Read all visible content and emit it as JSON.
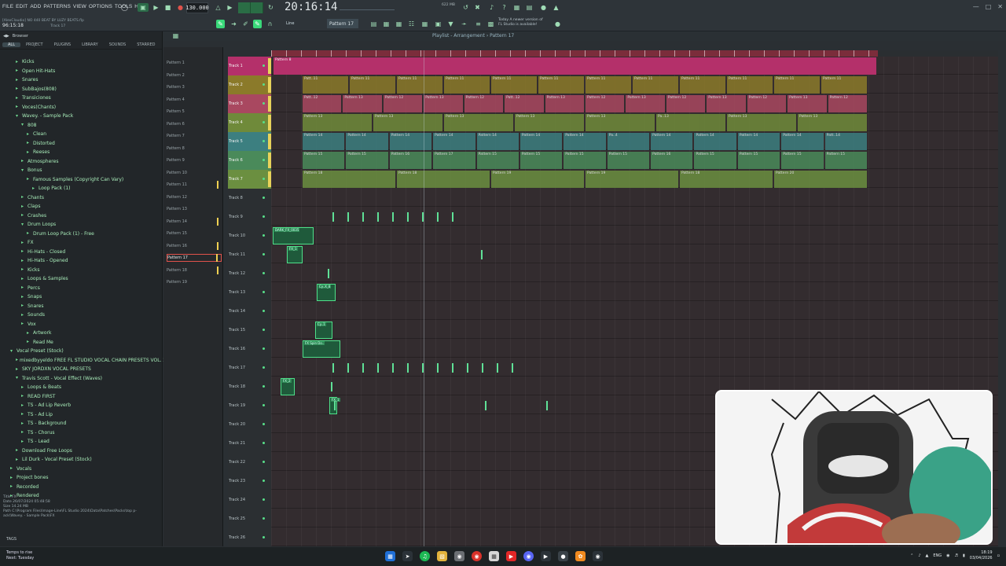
{
  "menu": [
    "FILE",
    "EDIT",
    "ADD",
    "PATTERNS",
    "VIEW",
    "OPTIONS",
    "TOOLS",
    "HELP"
  ],
  "tempo": "130.000",
  "clock": "20:16:14",
  "memory": "622 MB",
  "project_info": {
    "line1": "[AlexClaudio] NO 440 BEAT BY LUZY BEATS.flp",
    "position": "96:15:18",
    "track": "Track 17"
  },
  "pattern_selector": "Pattern 17",
  "snap_label": "Line",
  "update_note": [
    "Today  A newer version of",
    "FL Studio is available!"
  ],
  "browser": {
    "title": "Browser",
    "tabs": [
      "ALL",
      "PROJECT",
      "PLUGINS",
      "LIBRARY",
      "SOUNDS",
      "STARRED"
    ],
    "tree": [
      {
        "label": "Kicks",
        "indent": 2
      },
      {
        "label": "Open Hit-Hats",
        "indent": 2
      },
      {
        "label": "Snares",
        "indent": 2
      },
      {
        "label": "SubBajos(808)",
        "indent": 2
      },
      {
        "label": "Transiciones",
        "indent": 2
      },
      {
        "label": "Voces(Chants)",
        "indent": 2
      },
      {
        "label": "Wavey. - Sample Pack",
        "indent": 2,
        "open": true
      },
      {
        "label": "808",
        "indent": 3,
        "open": true
      },
      {
        "label": "Clean",
        "indent": 4
      },
      {
        "label": "Distorted",
        "indent": 4
      },
      {
        "label": "Reeses",
        "indent": 4
      },
      {
        "label": "Atmospheres",
        "indent": 3
      },
      {
        "label": "Bonus",
        "indent": 3,
        "open": true
      },
      {
        "label": "Famous Samples (Copyright Can Vary)",
        "indent": 4
      },
      {
        "label": "Loop Pack (1)",
        "indent": 5
      },
      {
        "label": "Chants",
        "indent": 3
      },
      {
        "label": "Claps",
        "indent": 3
      },
      {
        "label": "Crashes",
        "indent": 3
      },
      {
        "label": "Drum Loops",
        "indent": 3,
        "open": true
      },
      {
        "label": "Drum Loop Pack (1) - Free",
        "indent": 4
      },
      {
        "label": "FX",
        "indent": 3
      },
      {
        "label": "Hi-Hats - Closed",
        "indent": 3
      },
      {
        "label": "Hi-Hats - Opened",
        "indent": 3
      },
      {
        "label": "Kicks",
        "indent": 3
      },
      {
        "label": "Loops & Samples",
        "indent": 3
      },
      {
        "label": "Percs",
        "indent": 3
      },
      {
        "label": "Snaps",
        "indent": 3
      },
      {
        "label": "Snares",
        "indent": 3
      },
      {
        "label": "Sounds",
        "indent": 3
      },
      {
        "label": "Vox",
        "indent": 3
      },
      {
        "label": "Artwork",
        "indent": 4
      },
      {
        "label": "Read Me",
        "indent": 4
      },
      {
        "label": "Vocal Preset (Stock)",
        "indent": 1,
        "open": true
      },
      {
        "label": "mixedbyyeldo FREE FL STUDIO VOCAL CHAIN PRESETS VOL. 2",
        "indent": 2
      },
      {
        "label": "SKY JORDXN VOCAL PRESETS",
        "indent": 2
      },
      {
        "label": "Travis Scott - Vocal Effect (Waves)",
        "indent": 2,
        "open": true
      },
      {
        "label": "Loops & Beats",
        "indent": 3
      },
      {
        "label": "READ FIRST",
        "indent": 3
      },
      {
        "label": "TS - Ad Lip Reverb",
        "indent": 3
      },
      {
        "label": "TS - Ad Lip",
        "indent": 3
      },
      {
        "label": "TS - Background",
        "indent": 3
      },
      {
        "label": "TS - Chorus",
        "indent": 3
      },
      {
        "label": "TS - Lead",
        "indent": 3
      },
      {
        "label": "Download Free Loops",
        "indent": 2
      },
      {
        "label": "Lil Durk - Vocal Preset (Stock)",
        "indent": 2
      },
      {
        "label": "Vocals",
        "indent": 1
      },
      {
        "label": "Project bones",
        "indent": 1
      },
      {
        "label": "Recorded",
        "indent": 1
      },
      {
        "label": "Rendered",
        "indent": 1
      }
    ],
    "file_info": [
      "Title  FX",
      "Date  26/07/2024 05:48:58",
      "Size  14.24 MB",
      "Path  C:\\Program Files\\Image-Line\\FL Studio 2024\\Data\\Patches\\Packs\\top p-",
      "ack\\Wavey. - Sample Pack\\FX"
    ],
    "tags_label": "TAGS"
  },
  "playlist": {
    "title": "Playlist - Arrangement  › Pattern 17",
    "patterns": [
      "Pattern 1",
      "Pattern 2",
      "Pattern 3",
      "Pattern 4",
      "Pattern 5",
      "Pattern 6",
      "Pattern 7",
      "Pattern 8",
      "Pattern 9",
      "Pattern 10",
      "Pattern 11",
      "Pattern 12",
      "Pattern 13",
      "Pattern 14",
      "Pattern 15",
      "Pattern 16",
      "Pattern 17",
      "Pattern 18",
      "Pattern 19"
    ],
    "selected_pattern": "Pattern 17",
    "tracks": [
      "Track 1",
      "Track 2",
      "Track 3",
      "Track 4",
      "Track 5",
      "Track 6",
      "Track 7",
      "Track 8",
      "Track 9",
      "Track 10",
      "Track 11",
      "Track 12",
      "Track 13",
      "Track 14",
      "Track 15",
      "Track 16",
      "Track 17",
      "Track 18",
      "Track 19",
      "Track 20",
      "Track 21",
      "Track 22",
      "Track 23",
      "Track 24",
      "Track 25",
      "Track 26"
    ],
    "track_colors": [
      "#b4306a",
      "#8b7a2a",
      "#a94860",
      "#6f8a3a",
      "#3c7f80",
      "#4a8a5a",
      "#6b8f40"
    ],
    "ruler_numbers": [
      "3",
      "5",
      "7",
      "9",
      "11",
      "13",
      "15",
      "17",
      "19",
      "21",
      "23",
      "25",
      "27",
      "29",
      "31",
      "33",
      "35",
      "37",
      "39",
      "41",
      "43",
      "45",
      "47",
      "49",
      "51",
      "53",
      "55",
      "57",
      "59",
      "61",
      "63",
      "65",
      "67",
      "69",
      "71",
      "73",
      "75",
      "77",
      "79",
      "81",
      "83"
    ],
    "clips": [
      {
        "track": 0,
        "label": "Pattern 8",
        "repeat": true
      },
      {
        "track": 1,
        "labels": [
          "Patt..11",
          "Pattern 11",
          "Pattern 11",
          "Pattern 11",
          "Pattern 11",
          "Pattern 11",
          "Pattern 11",
          "Pattern 11",
          "Pattern 11",
          "Pattern 11",
          "Pattern 11",
          "Pattern 11"
        ]
      },
      {
        "track": 2,
        "labels": [
          "Patt..12",
          "Pattern 13",
          "Pattern 12",
          "Pattern 13",
          "Pattern 12",
          "Patt..12",
          "Pattern 13",
          "Pattern 12",
          "Pattern 13",
          "Pattern 12",
          "Pattern 13",
          "Pattern 12",
          "Pattern 13",
          "Pattern 12"
        ]
      },
      {
        "track": 3,
        "labels": [
          "Pattern 13",
          "Pattern 13",
          "Pattern 13",
          "Pattern 13",
          "Pattern 13",
          "Pa..13",
          "Pattern 13",
          "Pattern 13"
        ]
      },
      {
        "track": 4,
        "labels": [
          "Pattern 14",
          "Pattern 14",
          "Pattern 14",
          "Pattern 14",
          "Pattern 14",
          "Pattern 14",
          "Pattern 14",
          "Pa..4",
          "Pattern 14",
          "Pattern 14",
          "Pattern 14",
          "Pattern 14",
          "Patt..14"
        ]
      },
      {
        "track": 5,
        "labels": [
          "Pattern 15",
          "Pattern 15",
          "Pattern 16",
          "Pattern 17",
          "Pattern 15",
          "Pattern 15",
          "Pattern 15",
          "Pattern 15",
          "Pattern 16",
          "Pattern 15",
          "Pattern 15",
          "Pattern 15",
          "Pattern 15"
        ]
      },
      {
        "track": 6,
        "labels": [
          "Pattern 18",
          "Pattern 18",
          "Pattern 19",
          "Pattern 19",
          "Pattern 18",
          "Pattern 20"
        ]
      }
    ],
    "audio_labels": [
      "DARK_FX_0035",
      "FX_1",
      "Cy..X_8",
      "Cy..1",
      "FX Spin Do..",
      "FX_2",
      "FX_1"
    ]
  },
  "taskbar": {
    "weather": [
      "Temps to rise",
      "Next: Tuesday"
    ],
    "lang": "ENG",
    "time": "18:19",
    "date": "03/04/2026"
  }
}
